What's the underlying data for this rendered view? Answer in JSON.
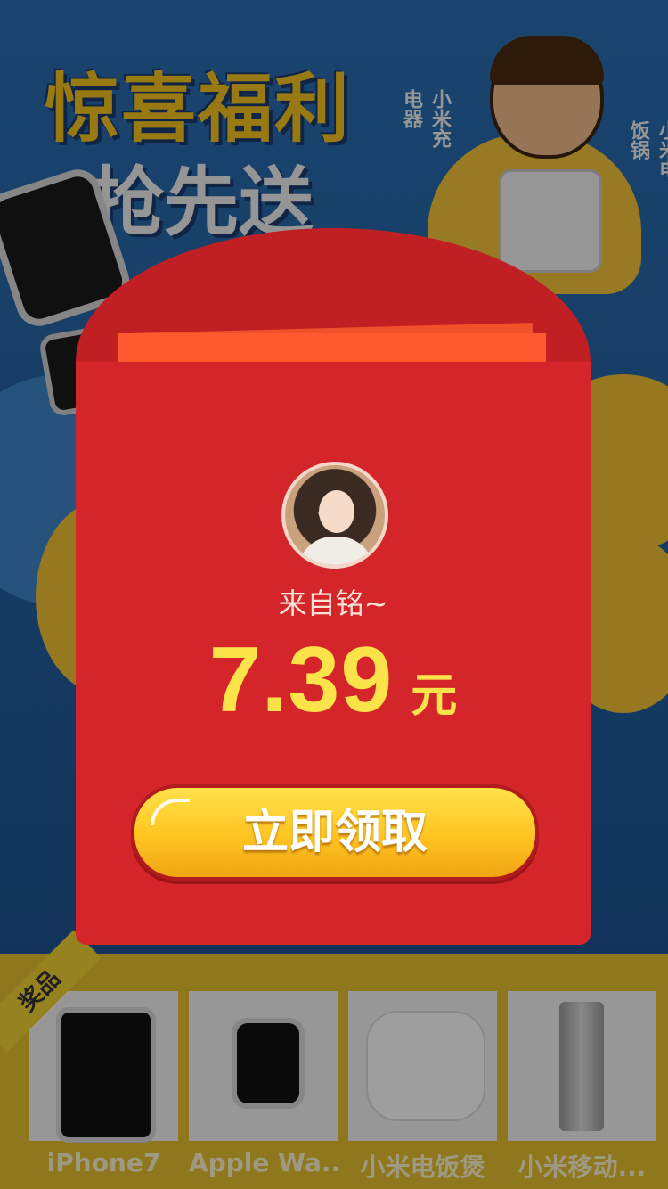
{
  "background": {
    "title_line1": "惊喜福利",
    "title_line2": "抢先送",
    "tag_charger": "小米充电器",
    "tag_cooker": "小米电饭锅"
  },
  "envelope": {
    "sender": "来自铭~",
    "amount": "7.39",
    "unit": "元",
    "claim_button": "立即领取",
    "colors": {
      "envelope": "#d4262a",
      "amount": "#fde34a",
      "button": "#ffc421"
    }
  },
  "prizes": {
    "tag": "奖品",
    "items": [
      {
        "label": "iPhone7",
        "icon": "iphone-icon"
      },
      {
        "label": "Apple Wa...",
        "icon": "apple-watch-icon"
      },
      {
        "label": "小米电饭煲",
        "icon": "rice-cooker-icon"
      },
      {
        "label": "小米移动...",
        "icon": "power-bank-icon"
      }
    ]
  }
}
